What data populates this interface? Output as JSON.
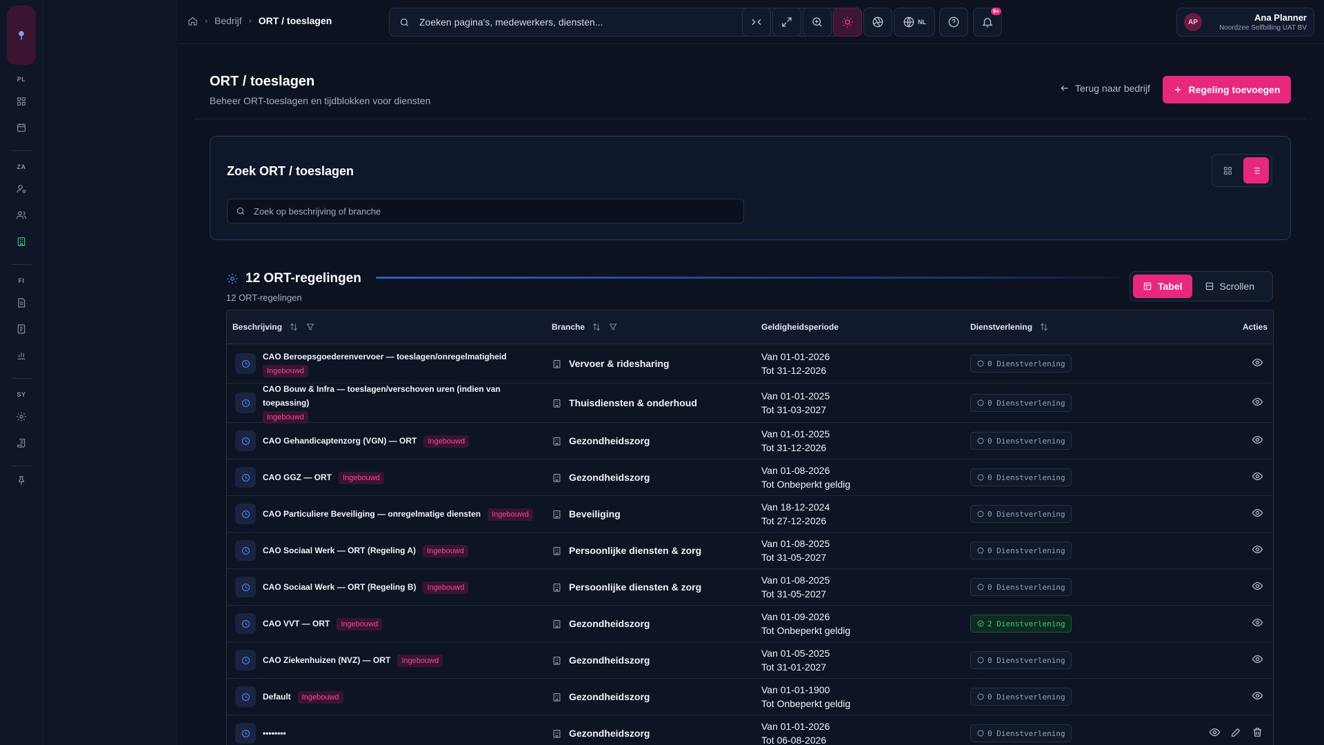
{
  "sidebar": {
    "sections": [
      "PL",
      "ZA",
      "FI",
      "SY"
    ]
  },
  "breadcrumb": {
    "items": [
      "Bedrijf"
    ],
    "current": "ORT / toeslagen"
  },
  "search": {
    "placeholder": "Zoeken pagina's, medewerkers, diensten..."
  },
  "topbar": {
    "lang": "NL",
    "notifications_badge": "9+"
  },
  "user": {
    "initials": "AP",
    "name": "Ana Planner",
    "company": "Noordzee Selfbilling UAT BV"
  },
  "page": {
    "title": "ORT / toeslagen",
    "subtitle": "Beheer ORT-toeslagen en tijdblokken voor diensten",
    "back_label": "Terug naar bedrijf",
    "add_label": "Regeling toevoegen"
  },
  "filter": {
    "title": "Zoek ORT / toeslagen",
    "placeholder": "Zoek op beschrijving of branche"
  },
  "results": {
    "title": "12 ORT-regelingen",
    "subtitle": "12 ORT-regelingen",
    "mode_table": "Tabel",
    "mode_scroll": "Scrollen"
  },
  "table": {
    "headers": {
      "description": "Beschrijving",
      "branch": "Branche",
      "period": "Geldigheidsperiode",
      "service": "Dienstverlening",
      "actions": "Acties"
    },
    "rows": [
      {
        "desc": "CAO Beroepsgoederenvervoer — toeslagen/onregelmatigheid",
        "tag": "Ingebouwd",
        "branch": "Vervoer & ridesharing",
        "from": "Van 01-01-2026",
        "to": "Tot 31-12-2026",
        "service": "0 Dienstverlening",
        "tall": true
      },
      {
        "desc": "CAO Bouw & Infra — toeslagen/verschoven uren (indien van toepassing)",
        "tag": "Ingebouwd",
        "branch": "Thuisdiensten & onderhoud",
        "from": "Van 01-01-2025",
        "to": "Tot 31-03-2027",
        "service": "0 Dienstverlening",
        "tall": true
      },
      {
        "desc": "CAO Gehandicaptenzorg (VGN) — ORT",
        "tag": "Ingebouwd",
        "branch": "Gezondheidszorg",
        "from": "Van 01-01-2025",
        "to": "Tot 31-12-2026",
        "service": "0 Dienstverlening"
      },
      {
        "desc": "CAO GGZ — ORT",
        "tag": "Ingebouwd",
        "branch": "Gezondheidszorg",
        "from": "Van 01-08-2026",
        "to": "Tot Onbeperkt geldig",
        "service": "0 Dienstverlening"
      },
      {
        "desc": "CAO Particuliere Beveiliging — onregelmatige diensten",
        "tag": "Ingebouwd",
        "branch": "Beveiliging",
        "from": "Van 18-12-2024",
        "to": "Tot 27-12-2026",
        "service": "0 Dienstverlening"
      },
      {
        "desc": "CAO Sociaal Werk — ORT (Regeling A)",
        "tag": "Ingebouwd",
        "branch": "Persoonlijke diensten & zorg",
        "from": "Van 01-08-2025",
        "to": "Tot 31-05-2027",
        "service": "0 Dienstverlening"
      },
      {
        "desc": "CAO Sociaal Werk — ORT (Regeling B)",
        "tag": "Ingebouwd",
        "branch": "Persoonlijke diensten & zorg",
        "from": "Van 01-08-2025",
        "to": "Tot 31-05-2027",
        "service": "0 Dienstverlening"
      },
      {
        "desc": "CAO VVT — ORT",
        "tag": "Ingebouwd",
        "branch": "Gezondheidszorg",
        "from": "Van 01-09-2026",
        "to": "Tot Onbeperkt geldig",
        "service": "2 Dienstverlening",
        "ok": true
      },
      {
        "desc": "CAO Ziekenhuizen (NVZ) — ORT",
        "tag": "Ingebouwd",
        "branch": "Gezondheidszorg",
        "from": "Van 01-05-2025",
        "to": "Tot 31-01-2027",
        "service": "0 Dienstverlening"
      },
      {
        "desc": "Default",
        "tag": "Ingebouwd",
        "branch": "Gezondheidszorg",
        "from": "Van 01-01-1900",
        "to": "Tot Onbeperkt geldig",
        "service": "0 Dienstverlening"
      },
      {
        "desc": "••••••••",
        "tag": "",
        "branch": "Gezondheidszorg",
        "from": "Van 01-01-2026",
        "to": "Tot 06-08-2026",
        "service": "0 Dienstverlening",
        "editable": true
      }
    ]
  }
}
